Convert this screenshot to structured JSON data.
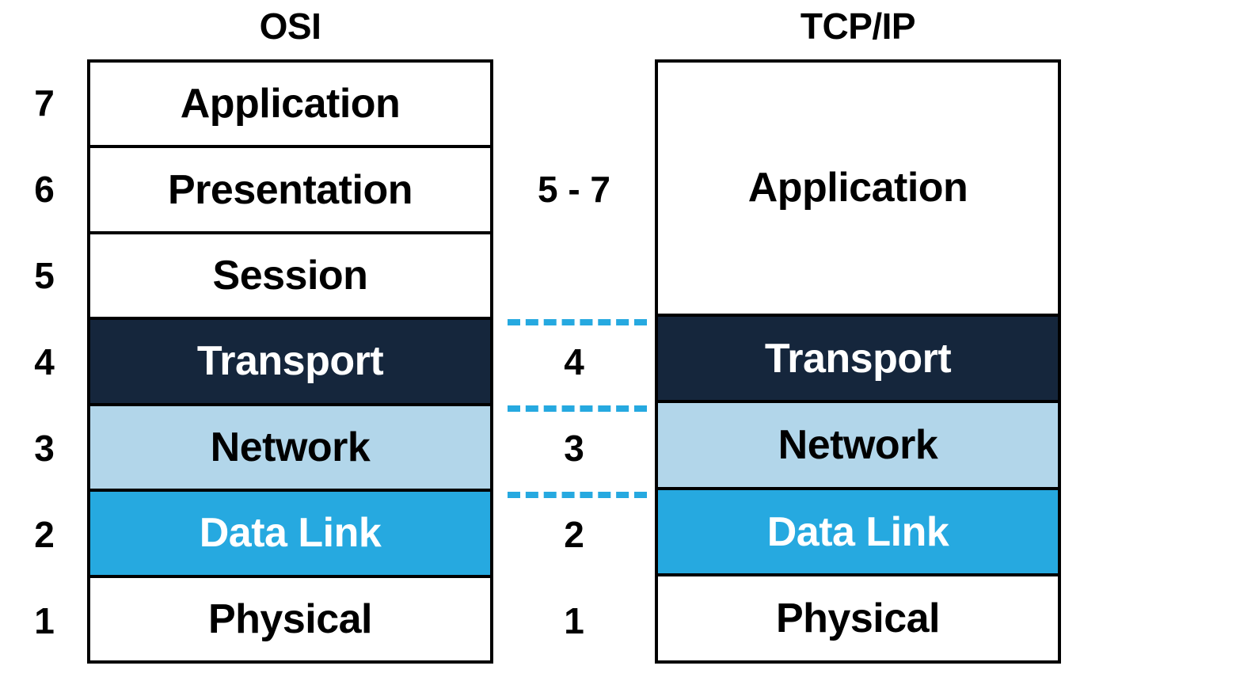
{
  "diagram": {
    "title_osi": "OSI",
    "title_tcpip": "TCP/IP",
    "osi_layer_numbers": [
      "7",
      "6",
      "5",
      "4",
      "3",
      "2",
      "1"
    ],
    "tcpip_layer_numbers": [
      "5 - 7",
      "4",
      "3",
      "2",
      "1"
    ],
    "osi_layers": [
      {
        "number": "7",
        "name": "Application",
        "fill": "#ffffff",
        "text": "#000000"
      },
      {
        "number": "6",
        "name": "Presentation",
        "fill": "#ffffff",
        "text": "#000000"
      },
      {
        "number": "5",
        "name": "Session",
        "fill": "#ffffff",
        "text": "#000000"
      },
      {
        "number": "4",
        "name": "Transport",
        "fill": "#15263c",
        "text": "#ffffff"
      },
      {
        "number": "3",
        "name": "Network",
        "fill": "#b2d6ea",
        "text": "#000000"
      },
      {
        "number": "2",
        "name": "Data Link",
        "fill": "#26a9e0",
        "text": "#ffffff"
      },
      {
        "number": "1",
        "name": "Physical",
        "fill": "#ffffff",
        "text": "#000000"
      }
    ],
    "tcpip_layers": [
      {
        "number": "5 - 7",
        "name": "Application",
        "fill": "#ffffff",
        "text": "#000000",
        "spans": 3
      },
      {
        "number": "4",
        "name": "Transport",
        "fill": "#15263c",
        "text": "#ffffff",
        "spans": 1
      },
      {
        "number": "3",
        "name": "Network",
        "fill": "#b2d6ea",
        "text": "#000000",
        "spans": 1
      },
      {
        "number": "2",
        "name": "Data Link",
        "fill": "#26a9e0",
        "text": "#ffffff",
        "spans": 1
      },
      {
        "number": "1",
        "name": "Physical",
        "fill": "#ffffff",
        "text": "#000000",
        "spans": 1
      }
    ],
    "connector_color": "#26a9e0",
    "connector_style": "dashed",
    "border_color": "#000000",
    "background": "#ffffff"
  }
}
